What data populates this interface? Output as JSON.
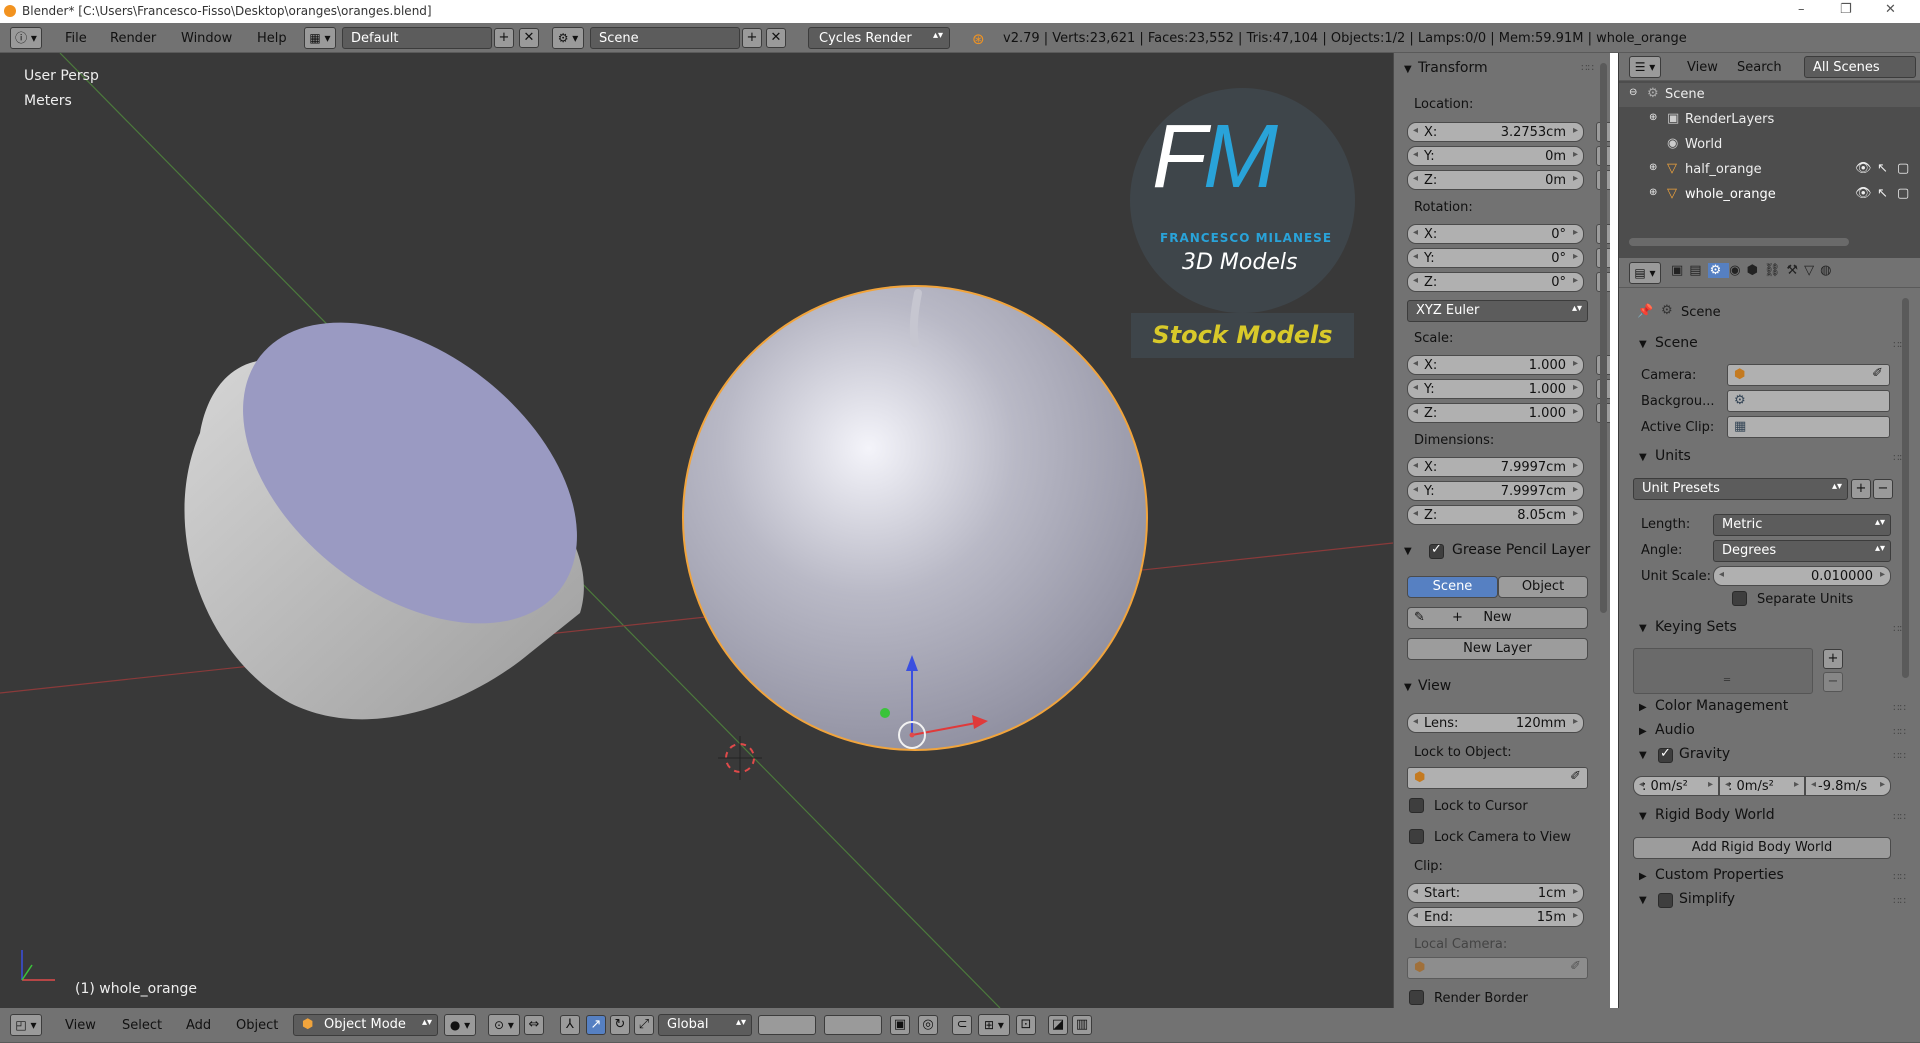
{
  "window": {
    "title": "Blender* [C:\\Users\\Francesco-Fisso\\Desktop\\oranges\\oranges.blend]",
    "minimize": "–",
    "maximize": "❐",
    "close": "✕"
  },
  "topbar": {
    "menus": [
      "File",
      "Render",
      "Window",
      "Help"
    ],
    "screen_layout": "Default",
    "scene": "Scene",
    "engine": "Cycles Render",
    "stats": "v2.79 | Verts:23,621 | Faces:23,552 | Tris:47,104 | Objects:1/2 | Lamps:0/0 | Mem:59.91M | whole_orange"
  },
  "viewport": {
    "view_name": "User Persp",
    "units": "Meters",
    "active_object": "(1) whole_orange",
    "logo": {
      "initials": "FM",
      "name": "FRANCESCO MILANESE",
      "tagline": "3D Models",
      "banner": "Stock Models"
    }
  },
  "npanel": {
    "transform": {
      "header": "Transform",
      "location_label": "Location:",
      "location": [
        {
          "k": "X:",
          "v": "3.2753cm"
        },
        {
          "k": "Y:",
          "v": "0m"
        },
        {
          "k": "Z:",
          "v": "0m"
        }
      ],
      "rotation_label": "Rotation:",
      "rotation": [
        {
          "k": "X:",
          "v": "0°"
        },
        {
          "k": "Y:",
          "v": "0°"
        },
        {
          "k": "Z:",
          "v": "0°"
        }
      ],
      "rotation_mode": "XYZ Euler",
      "scale_label": "Scale:",
      "scale": [
        {
          "k": "X:",
          "v": "1.000"
        },
        {
          "k": "Y:",
          "v": "1.000"
        },
        {
          "k": "Z:",
          "v": "1.000"
        }
      ],
      "dimensions_label": "Dimensions:",
      "dimensions": [
        {
          "k": "X:",
          "v": "7.9997cm"
        },
        {
          "k": "Y:",
          "v": "7.9997cm"
        },
        {
          "k": "Z:",
          "v": "8.05cm"
        }
      ]
    },
    "grease_pencil": {
      "header": "Grease Pencil Layer",
      "scene_tab": "Scene",
      "object_tab": "Object",
      "new_button": "New",
      "new_layer_button": "New Layer"
    },
    "view": {
      "header": "View",
      "lens_label": "Lens:",
      "lens_value": "120mm",
      "lock_to_object_label": "Lock to Object:",
      "lock_to_cursor": "Lock to Cursor",
      "lock_camera_to_view": "Lock Camera to View",
      "clip_label": "Clip:",
      "clip_start_label": "Start:",
      "clip_start": "1cm",
      "clip_end_label": "End:",
      "clip_end": "15m",
      "local_camera_label": "Local Camera:",
      "render_border": "Render Border"
    }
  },
  "outliner": {
    "menus": [
      "View",
      "Search"
    ],
    "filter": "All Scenes",
    "items": [
      "Scene",
      "RenderLayers",
      "World",
      "half_orange",
      "whole_orange"
    ]
  },
  "properties": {
    "context": "Scene",
    "scene": {
      "header": "Scene",
      "camera_label": "Camera:",
      "background_label": "Backgrou...",
      "active_clip_label": "Active Clip:"
    },
    "units": {
      "header": "Units",
      "presets": "Unit Presets",
      "length_label": "Length:",
      "length": "Metric",
      "angle_label": "Angle:",
      "angle": "Degrees",
      "unit_scale_label": "Unit Scale:",
      "unit_scale": "0.010000",
      "separate_units": "Separate Units"
    },
    "keying_sets": {
      "header": "Keying Sets"
    },
    "color_management": {
      "header": "Color Management"
    },
    "audio": {
      "header": "Audio"
    },
    "gravity": {
      "header": "Gravity",
      "values": [
        ": 0m/s²",
        ": 0m/s²",
        "-9.8m/s"
      ]
    },
    "rigid_body": {
      "header": "Rigid Body World",
      "button": "Add Rigid Body World"
    },
    "custom_properties": {
      "header": "Custom Properties"
    },
    "simplify": {
      "header": "Simplify"
    }
  },
  "bottombar": {
    "menus": [
      "View",
      "Select",
      "Add",
      "Object"
    ],
    "mode": "Object Mode",
    "orientation": "Global"
  },
  "colors": {
    "accent_blue": "#5680c2",
    "selection_orange": "#f1a43c",
    "logo_cyan": "#29a3d9",
    "logo_yellow": "#d8c92a"
  }
}
